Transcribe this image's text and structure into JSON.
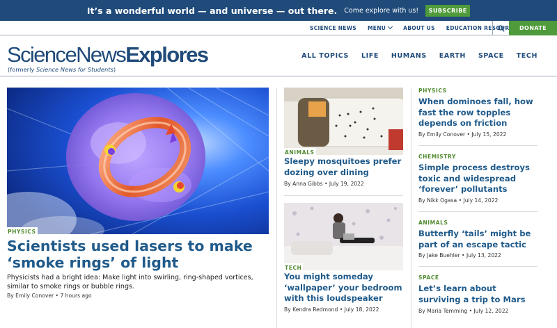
{
  "banner": {
    "headline": "It’s a wonderful world — and universe — out there.",
    "sub": "Come explore with us!",
    "subscribe_label": "SUBSCRIBE"
  },
  "utility_nav": {
    "science_news": "SCIENCE NEWS",
    "menu": "MENU",
    "about_us": "ABOUT US",
    "education_resources": "EDUCATION RESOURCES",
    "donate_label": "DONATE"
  },
  "logo": {
    "part1": "ScienceNews",
    "part2": "Explores",
    "subtitle_prefix": "(formerly ",
    "subtitle_italic": "Science News for Students",
    "subtitle_suffix": ")"
  },
  "main_nav": [
    "ALL TOPICS",
    "LIFE",
    "HUMANS",
    "EARTH",
    "SPACE",
    "TECH"
  ],
  "hero": {
    "category": "PHYSICS",
    "title": "Scientists used lasers to make ‘smoke rings’ of light",
    "description": "Physicists had a bright idea: Make light into swirling, ring-shaped vortices, similar to smoke rings or bubble rings.",
    "byline": "By Emily Conover • 7 hours ago"
  },
  "middle_cards": [
    {
      "category": "ANIMALS",
      "title": "Sleepy mosquitoes prefer dozing over dining",
      "byline": "By Anna Gibbs • July 19, 2022"
    },
    {
      "category": "TECH",
      "title": "You might someday ‘wallpaper’ your bedroom with this loudspeaker",
      "byline": "By Kendra Redmond • July 18, 2022"
    }
  ],
  "right_cards": [
    {
      "category": "PHYSICS",
      "title": "When dominoes fall, how fast the row topples depends on friction",
      "byline": "By Emily Conover • July 15, 2022"
    },
    {
      "category": "CHEMISTRY",
      "title": "Simple process destroys toxic and widespread ‘forever’ pollutants",
      "byline": "By Nikk Ogasa • July 14, 2022"
    },
    {
      "category": "ANIMALS",
      "title": "Butterfly ‘tails’ might be part of an escape tactic",
      "byline": "By Jake Buehler • July 13, 2022"
    },
    {
      "category": "SPACE",
      "title": "Let’s learn about surviving a trip to Mars",
      "byline": "By Maria Temming • July 12, 2022"
    }
  ],
  "colors": {
    "brand_blue": "#1f4a7a",
    "link_blue": "#1f5a8a",
    "accent_green": "#4f9a3b",
    "category_green": "#4f8a2e"
  },
  "icons": {
    "search": "search-icon",
    "menu_chevron": "chevron-down-icon"
  }
}
